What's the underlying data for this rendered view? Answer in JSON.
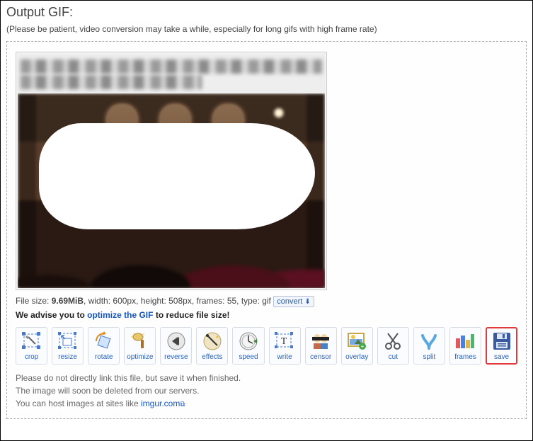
{
  "header": {
    "title": "Output GIF:",
    "subtitle": "(Please be patient, video conversion may take a while, especially for long gifs with high frame rate)"
  },
  "fileinfo": {
    "prefix": "File size: ",
    "size": "9.69MiB",
    "rest": ", width: 600px, height: 508px, frames: 55, type: gif",
    "convert_label": "convert"
  },
  "advise": {
    "before": "We advise you to ",
    "link": "optimize the GIF",
    "after": " to reduce file size!"
  },
  "tools": {
    "crop": "crop",
    "resize": "resize",
    "rotate": "rotate",
    "optimize": "optimize",
    "reverse": "reverse",
    "effects": "effects",
    "speed": "speed",
    "write": "write",
    "censor": "censor",
    "overlay": "overlay",
    "cut": "cut",
    "split": "split",
    "frames": "frames",
    "save": "save"
  },
  "notes": {
    "line1": "Please do not directly link this file, but save it when finished.",
    "line2": "The image will soon be deleted from our servers.",
    "line3_before": "You can host images at sites like ",
    "line3_link": "imgur.com"
  }
}
